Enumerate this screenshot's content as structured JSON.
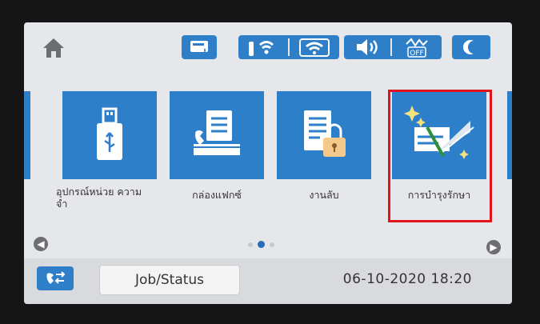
{
  "header": {
    "status_icons": [
      {
        "name": "ink-cartridge-icon"
      },
      {
        "name": "wired-network-icon"
      },
      {
        "name": "wifi-direct-icon"
      },
      {
        "name": "volume-icon"
      },
      {
        "name": "eco-off-icon",
        "text": "OFF"
      },
      {
        "name": "sleep-moon-icon"
      }
    ]
  },
  "tiles": [
    {
      "name": "tile-memory-device",
      "label": "อุปกรณ์หน่วย ความจำ",
      "icon": "usb-drive-icon"
    },
    {
      "name": "tile-fax-box",
      "label": "กล่องแฟกซ์",
      "icon": "fax-inbox-icon"
    },
    {
      "name": "tile-confidential-job",
      "label": "งานลับ",
      "icon": "locked-document-icon"
    },
    {
      "name": "tile-maintenance",
      "label": "การบำรุงรักษา",
      "icon": "print-head-clean-icon"
    }
  ],
  "pager": {
    "total": 3,
    "active_index": 1
  },
  "footer": {
    "job_status_label": "Job/Status",
    "datetime": "06-10-2020 18:20"
  },
  "colors": {
    "tile_blue": "#2e7fc9",
    "highlight_red": "#e0141c",
    "screen_bg": "#e6e7ea"
  }
}
